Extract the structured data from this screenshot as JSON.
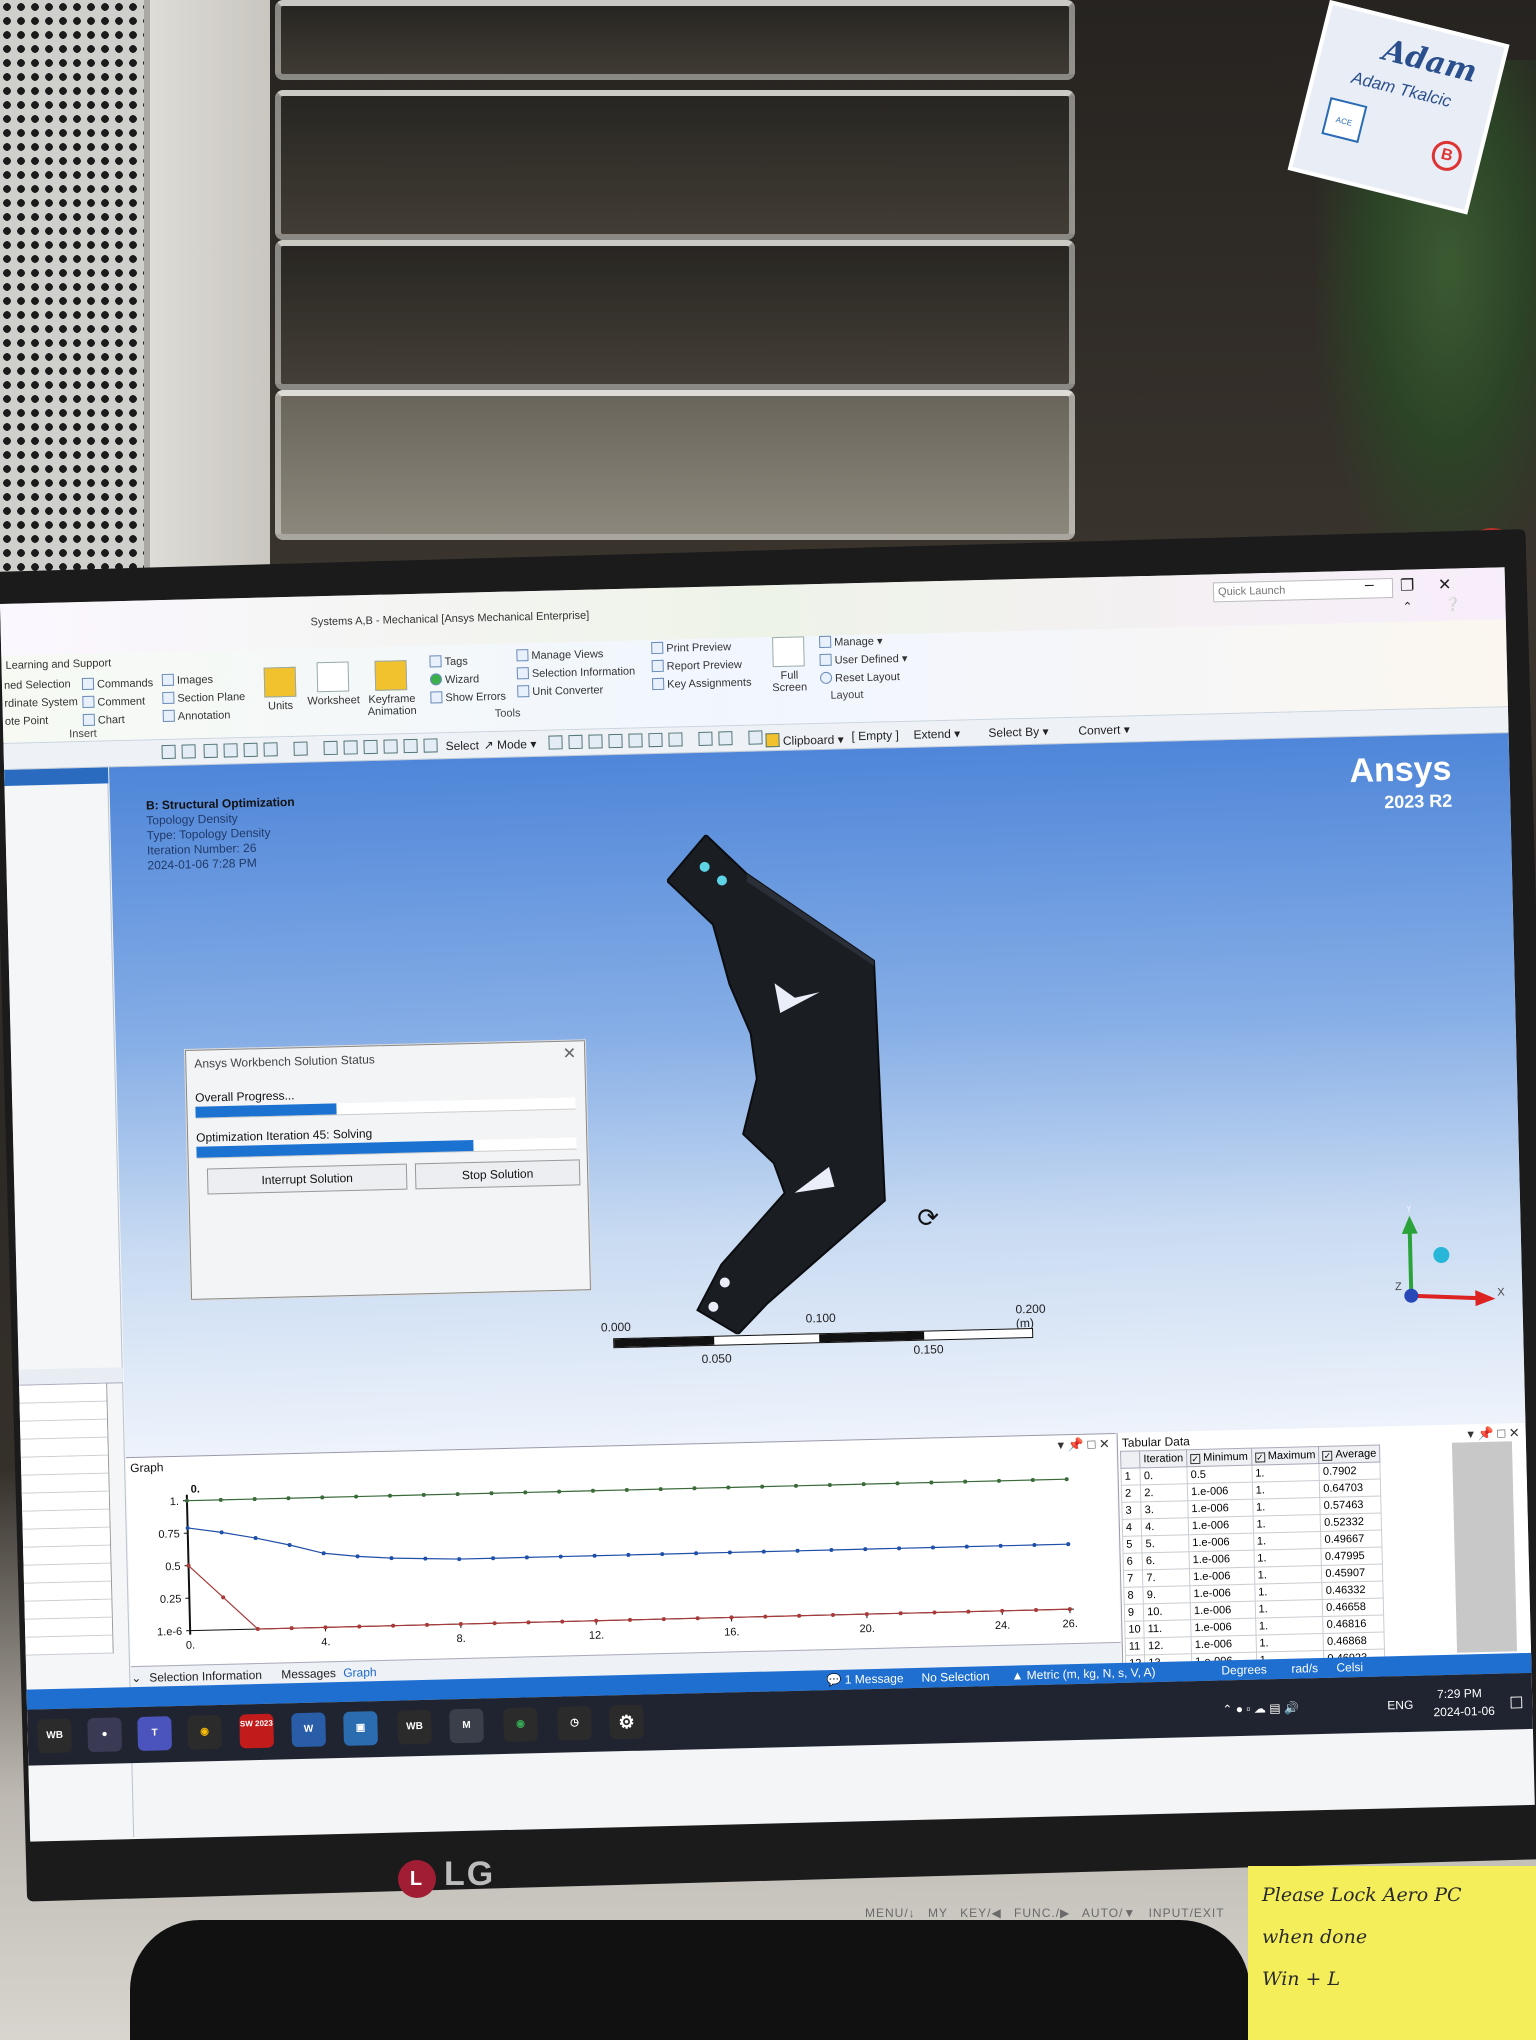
{
  "window": {
    "title": "Systems A,B - Mechanical [Ansys Mechanical Enterprise]",
    "quick_launch_placeholder": "Quick Launch"
  },
  "ribbon": {
    "group_learning": "Learning and Support",
    "insert_items": [
      "ned Selection",
      "rdinate System",
      "ote Point"
    ],
    "insert_items2": [
      "Commands",
      "Comment",
      "Chart"
    ],
    "insert_items3": [
      "Images",
      "Section Plane",
      "Annotation"
    ],
    "insert_label": "Insert",
    "units_label": "Units",
    "worksheet_label": "Worksheet",
    "keyframe_label_1": "Keyframe",
    "keyframe_label_2": "Animation",
    "tools_items": [
      "Tags",
      "Wizard",
      "Show Errors"
    ],
    "tools_items2": [
      "Manage Views",
      "Selection Information",
      "Unit Converter"
    ],
    "tools_items3": [
      "Print Preview",
      "Report Preview",
      "Key Assignments"
    ],
    "tools_label": "Tools",
    "full_screen_1": "Full",
    "full_screen_2": "Screen",
    "layout_items": [
      "Manage",
      "User Defined",
      "Reset Layout"
    ],
    "layout_label": "Layout"
  },
  "toolbar": {
    "select_label": "Select",
    "mode_label": "Mode",
    "clipboard_label": "Clipboard",
    "empty_label": "[ Empty ]",
    "extend_label": "Extend",
    "select_by_label": "Select By",
    "convert_label": "Convert"
  },
  "viewport": {
    "analysis_title": "B: Structural Optimization",
    "result_name": "Topology Density",
    "result_type": "Type: Topology Density",
    "iteration": "Iteration Number: 26",
    "timestamp": "2024-01-06 7:28 PM",
    "brand": "Ansys",
    "version": "2023 R2",
    "axis_y": "Y",
    "axis_x": "X",
    "axis_z": "Z",
    "scale_top": [
      "0.000",
      "0.100",
      "0.200 (m)"
    ],
    "scale_bottom": [
      "0.050",
      "0.150"
    ]
  },
  "solution_status": {
    "title": "Ansys Workbench Solution Status",
    "overall_label": "Overall Progress...",
    "overall_progress": 0.37,
    "iteration_label": "Optimization Iteration 45: Solving",
    "iteration_progress": 0.73,
    "interrupt_label": "Interrupt Solution",
    "stop_label": "Stop Solution"
  },
  "graph": {
    "title": "Graph",
    "tabs": [
      "Selection Information",
      "Messages",
      "Graph"
    ]
  },
  "chart_data": {
    "type": "line",
    "x": [
      0,
      1,
      2,
      3,
      4,
      5,
      6,
      7,
      8,
      9,
      10,
      11,
      12,
      13,
      14,
      15,
      16,
      17,
      18,
      19,
      20,
      21,
      22,
      23,
      24,
      25,
      26
    ],
    "series": [
      {
        "values": [
          1,
          1,
          1,
          1,
          1,
          1,
          1,
          1,
          1,
          1,
          1,
          1,
          1,
          1,
          1,
          1,
          1,
          1,
          1,
          1,
          1,
          1,
          1,
          1,
          1,
          1,
          1
        ],
        "color": "#3a6a3a"
      },
      {
        "values": [
          0.7902,
          0.75,
          0.7,
          0.64,
          0.57,
          0.54,
          0.52,
          0.51,
          0.5,
          0.5,
          0.5,
          0.5,
          0.5,
          0.5,
          0.5,
          0.5,
          0.5,
          0.5,
          0.5,
          0.5,
          0.5,
          0.5,
          0.5,
          0.5,
          0.5,
          0.5,
          0.5
        ],
        "color": "#1f4fa8"
      },
      {
        "values": [
          0.5,
          0.25,
          1e-06,
          1e-06,
          1e-06,
          1e-06,
          1e-06,
          1e-06,
          1e-06,
          1e-06,
          1e-06,
          1e-06,
          1e-06,
          1e-06,
          1e-06,
          1e-06,
          1e-06,
          1e-06,
          1e-06,
          1e-06,
          1e-06,
          1e-06,
          1e-06,
          1e-06,
          1e-06,
          1e-06,
          1e-06
        ],
        "color": "#a83a3a"
      }
    ],
    "x_ticks": [
      "0.",
      "4.",
      "8.",
      "12.",
      "16.",
      "20.",
      "24.",
      "26."
    ],
    "y_ticks": [
      "1.",
      "0.75",
      "0.5",
      "0.25",
      "1.e-6"
    ],
    "y_top_label": "0.",
    "xlim": [
      0,
      26
    ],
    "ylim": [
      0,
      1
    ]
  },
  "tabular": {
    "title": "Tabular Data",
    "headers": [
      "Iteration",
      "Minimum",
      "Maximum",
      "Average"
    ],
    "rows": [
      [
        "1",
        "0.",
        "0.5",
        "1.",
        "0.7902"
      ],
      [
        "2",
        "2.",
        "1.e-006",
        "1.",
        "0.64703"
      ],
      [
        "3",
        "3.",
        "1.e-006",
        "1.",
        "0.57463"
      ],
      [
        "4",
        "4.",
        "1.e-006",
        "1.",
        "0.52332"
      ],
      [
        "5",
        "5.",
        "1.e-006",
        "1.",
        "0.49667"
      ],
      [
        "6",
        "6.",
        "1.e-006",
        "1.",
        "0.47995"
      ],
      [
        "7",
        "7.",
        "1.e-006",
        "1.",
        "0.45907"
      ],
      [
        "8",
        "9.",
        "1.e-006",
        "1.",
        "0.46332"
      ],
      [
        "9",
        "10.",
        "1.e-006",
        "1.",
        "0.46658"
      ],
      [
        "10",
        "11.",
        "1.e-006",
        "1.",
        "0.46816"
      ],
      [
        "11",
        "12.",
        "1.e-006",
        "1.",
        "0.46868"
      ],
      [
        "12",
        "13.",
        "1.e-006",
        "1.",
        "0.46923"
      ]
    ]
  },
  "statusbar": {
    "messages": "1 Message",
    "selection": "No Selection",
    "units": "Metric (m, kg, N, s, V, A)",
    "degrees": "Degrees",
    "rads": "rad/s",
    "temp": "Celsi"
  },
  "taskbar": {
    "apps": [
      "WB",
      "T",
      "W",
      "SW 2023",
      "WB",
      "M"
    ],
    "lang": "ENG",
    "time": "7:29 PM",
    "date": "2024-01-06"
  },
  "desk": {
    "monitor_brand": "LG",
    "monitor_buttons": "MENU/↓ MY KEY/◀ FUNC./▶ AUTO/▼ INPUT/EXIT",
    "sticky_lines": [
      "Please Lock Aero PC",
      "when done",
      "Win + L"
    ],
    "badge_name": "Adam",
    "badge_sub": "Adam Tkalcic",
    "badge_logo": "ACE",
    "badge_tag": "B"
  }
}
